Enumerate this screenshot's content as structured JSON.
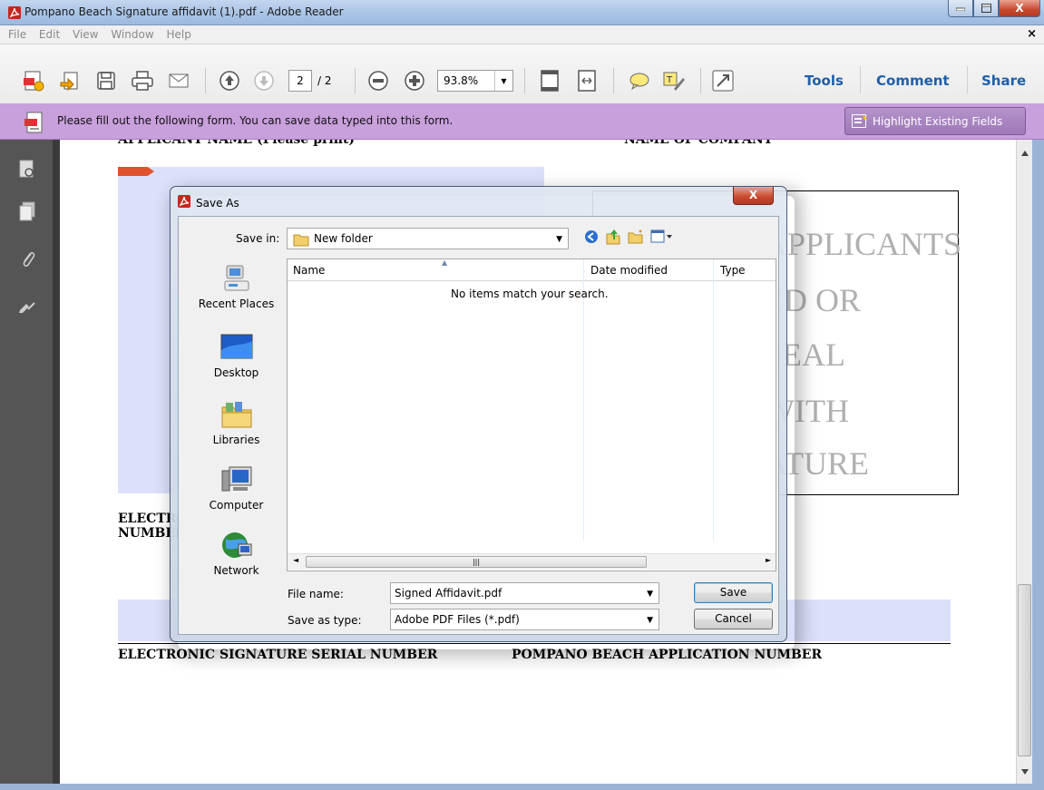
{
  "window": {
    "title": "Pompano Beach Signature affidavit (1).pdf - Adobe Reader",
    "minimize": "–",
    "maximize": "□",
    "close": "X"
  },
  "menu": {
    "items": [
      "File",
      "Edit",
      "View",
      "Window",
      "Help"
    ],
    "close_doc": "×"
  },
  "toolbar": {
    "page_current": "2",
    "page_total": "/ 2",
    "zoom": "93.8%",
    "links": [
      "Tools",
      "Comment",
      "Share"
    ]
  },
  "formbar": {
    "message": "Please fill out the following form. You can save data typed into this form.",
    "highlight_button": "Highlight Existing Fields",
    "color": "#c8a0dc"
  },
  "document": {
    "header_left": "APPLICANT NAME (Please print)",
    "header_right": "NAME OF COMPANY",
    "box_lines": [
      "APPLICANTS",
      "ED OR",
      "SEAL",
      "WITH",
      "ATURE"
    ],
    "label_elec_1": "ELECTRONIC SIGNATURE SERIAL",
    "label_elec_2": "NUMBER",
    "footer_left": "ELECTRONIC SIGNATURE SERIAL NUMBER",
    "footer_right": "POMPANO BEACH APPLICATION NUMBER"
  },
  "dialog": {
    "title": "Save As",
    "close": "X",
    "save_in_label": "Save in:",
    "save_in_value": "New folder",
    "places": [
      "Recent Places",
      "Desktop",
      "Libraries",
      "Computer",
      "Network"
    ],
    "columns": [
      "Name",
      "Date modified",
      "Type"
    ],
    "empty_message": "No items match your search.",
    "file_name_label": "File name:",
    "file_name_value": "Signed Affidavit.pdf",
    "save_type_label": "Save as type:",
    "save_type_value": "Adobe PDF Files (*.pdf)",
    "save_button": "Save",
    "cancel_button": "Cancel"
  }
}
